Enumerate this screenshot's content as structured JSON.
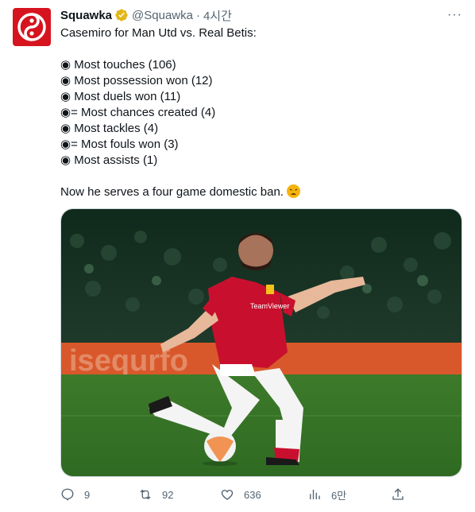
{
  "tweet": {
    "name": "Squawka",
    "handle": "@Squawka",
    "separator": "·",
    "time": "4시간",
    "more_label": "···",
    "lines": [
      "Casemiro for Man Utd vs. Real Betis:",
      "",
      "◉ Most touches (106)",
      "◉ Most possession won (12)",
      "◉ Most duels won (11)",
      "◉= Most chances created (4)",
      "◉ Most tackles (4)",
      "◉= Most fouls won (3)",
      "◉ Most assists (1)",
      "",
      "Now he serves a four game domestic ban."
    ],
    "emoji_icon": "weary-face-emoji",
    "image_icon": "player-photo",
    "actions": {
      "replies": "9",
      "retweets": "92",
      "likes": "636",
      "views": "6만"
    },
    "colors": {
      "brand": "#d6141f",
      "verified": "#e2b719",
      "text": "#0f1419",
      "muted": "#536471"
    }
  }
}
